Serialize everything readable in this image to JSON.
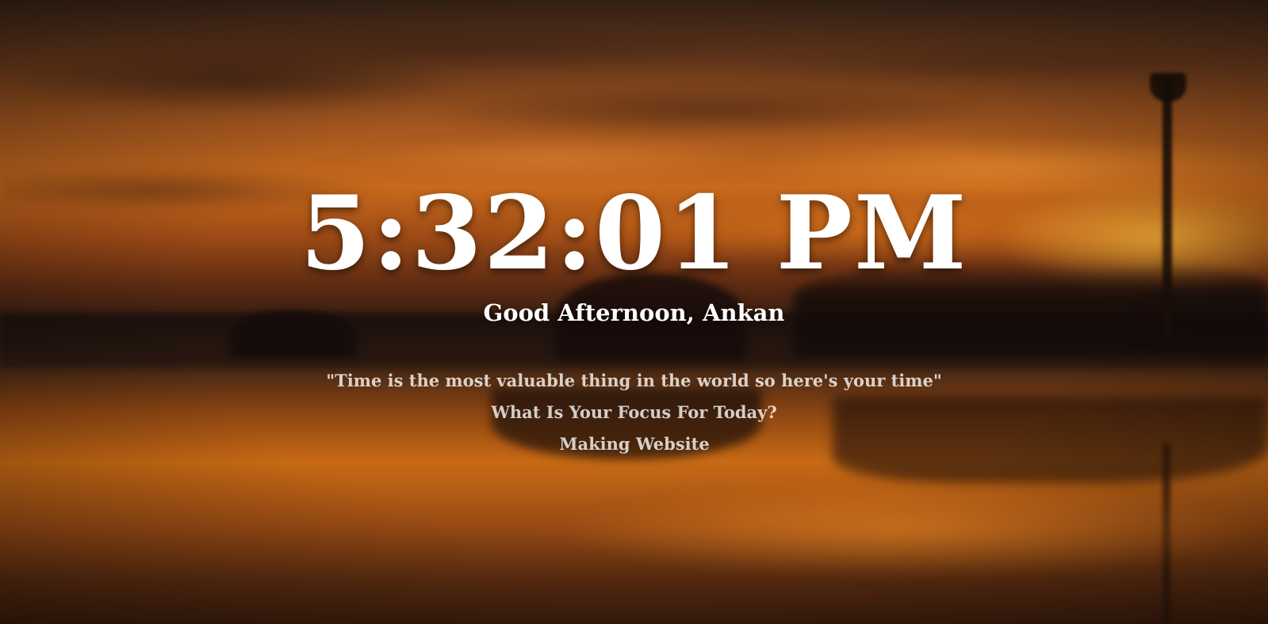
{
  "clock": {
    "time": "5:32:01 PM"
  },
  "greeting": {
    "text": "Good Afternoon, Ankan"
  },
  "quote": {
    "text": "\"Time is the most valuable thing in the world so here's your time\""
  },
  "focus": {
    "question": "What Is Your Focus For Today?",
    "value": "Making Website"
  },
  "background": {
    "description_color_top": "#3a2418",
    "accent_orange": "#c96a1c"
  }
}
